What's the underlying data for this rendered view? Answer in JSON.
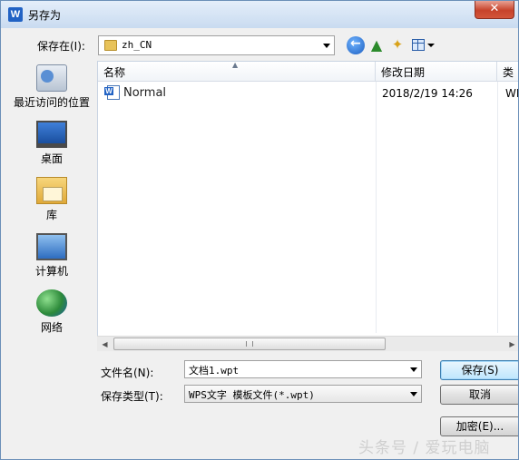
{
  "window": {
    "title": "另存为",
    "app_icon_letter": "W",
    "close_glyph": "✕"
  },
  "location": {
    "label": "保存在(I):",
    "current_folder": "zh_CN"
  },
  "places": [
    {
      "label": "最近访问的位置",
      "icon": "recent-places-icon"
    },
    {
      "label": "桌面",
      "icon": "desktop-icon"
    },
    {
      "label": "库",
      "icon": "libraries-icon"
    },
    {
      "label": "计算机",
      "icon": "computer-icon"
    },
    {
      "label": "网络",
      "icon": "network-icon"
    }
  ],
  "file_list": {
    "columns": [
      "名称",
      "修改日期",
      "类型"
    ],
    "rows": [
      {
        "name": "Normal",
        "modified": "2018/2/19 14:26",
        "type": "WP"
      }
    ]
  },
  "form": {
    "filename_label": "文件名(N):",
    "filename_value": "文档1.wpt",
    "filetype_label": "保存类型(T):",
    "filetype_value": "WPS文字 模板文件(*.wpt)"
  },
  "buttons": {
    "save": "保存(S)",
    "cancel": "取消",
    "encrypt": "加密(E)..."
  },
  "watermark": "头条号 / 爱玩电脑",
  "colors": {
    "accent": "#2162c4",
    "close": "#c7432b"
  }
}
